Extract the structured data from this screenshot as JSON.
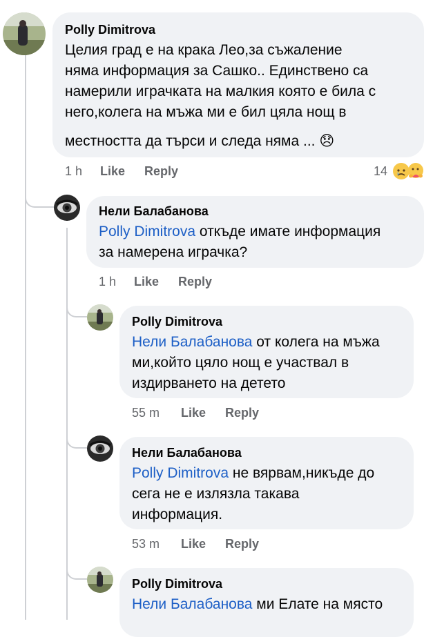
{
  "comments": [
    {
      "author": "Polly Dimitrova",
      "lines": [
        "Целия град е на крака Лео,за съжаление",
        "няма информация за Сашко.. Единствено са",
        "намерили играчката на малкия която е била с",
        "него,колега на мъжа ми е бил цяла нощ в",
        "местността да търси и следа няма ..."
      ],
      "emoji": "😞",
      "time": "1 h",
      "like": "Like",
      "reply": "Reply",
      "reaction_count": "14"
    },
    {
      "author": "Нели Балабанова",
      "mention": "Polly Dimitrova",
      "line1_rest": " откъде имате информация",
      "lines": [
        "за намерена играчка?"
      ],
      "time": "1 h",
      "like": "Like",
      "reply": "Reply"
    },
    {
      "author": "Polly Dimitrova",
      "mention": "Нели Балабанова",
      "line1_rest": " от колега на мъжа",
      "lines": [
        "ми,който цяло нощ е участвал в",
        "издирването на детето"
      ],
      "time": "55 m",
      "like": "Like",
      "reply": "Reply"
    },
    {
      "author": "Нели Балабанова",
      "mention": "Polly Dimitrova",
      "line1_rest": " не вярвам,никъде до",
      "lines": [
        "сега не е излязла такава",
        "информация."
      ],
      "time": "53 m",
      "like": "Like",
      "reply": "Reply"
    },
    {
      "author": "Polly Dimitrova",
      "mention": "Нели Балабанова",
      "line1_rest": " ми Елате на място"
    }
  ],
  "icons": {
    "avatar_polly": "avatar-icon",
    "avatar_neli": "avatar-icon",
    "reaction_sad": "sad-reaction-icon",
    "reaction_care": "care-reaction-icon"
  },
  "colors": {
    "bubble": "#f0f2f5",
    "mention": "#1d5fc6",
    "meta": "#65676b",
    "thread_line": "#ced0d4"
  }
}
